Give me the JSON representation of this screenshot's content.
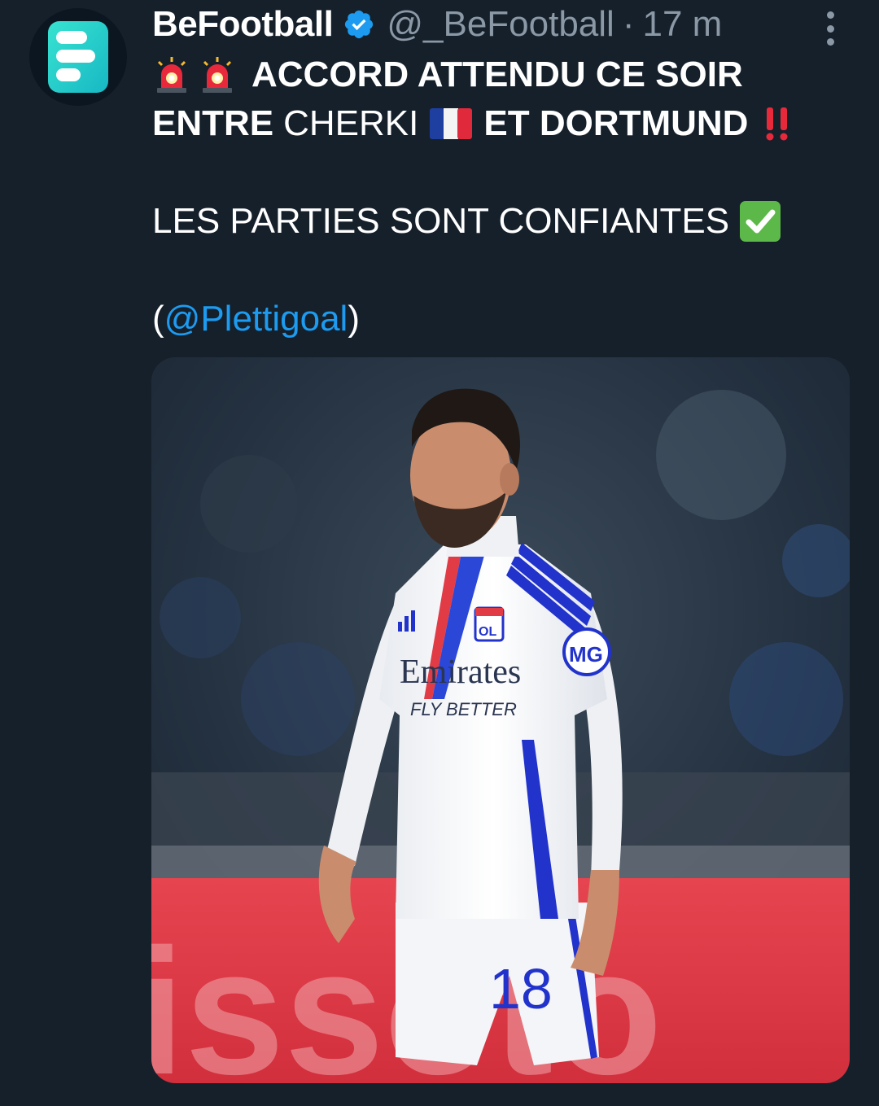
{
  "tweet": {
    "author_name": "BeFootball",
    "author_handle": "@_BeFootball",
    "separator": "·",
    "timestamp": "17 m",
    "text": {
      "line1_text": "ACCORD ATTENDU CE SOIR",
      "line2_part1": "ENTRE",
      "line2_part2": "CHERKI",
      "line2_part3": "ET DORTMUND",
      "line3_text": "LES PARTIES SONT CONFIANTES",
      "mention_open": "(",
      "mention": "@Plettigoal",
      "mention_close": ")"
    },
    "media": {
      "jersey_sponsor": "Emirates",
      "jersey_tagline": "FLY BETTER",
      "shirt_number": "18",
      "sleeve_badge": "MG",
      "crest_text": "OL",
      "banner_text": "issoto"
    }
  },
  "colors": {
    "background": "#15202b",
    "text": "#ffffff",
    "muted": "#8b98a5",
    "link": "#1d9bf0",
    "verified": "#1d9bf0"
  },
  "icons": [
    "brand-logo-icon",
    "verified-icon",
    "more-options-icon",
    "siren-icon",
    "france-flag-icon",
    "double-exclamation-icon",
    "check-mark-icon"
  ]
}
